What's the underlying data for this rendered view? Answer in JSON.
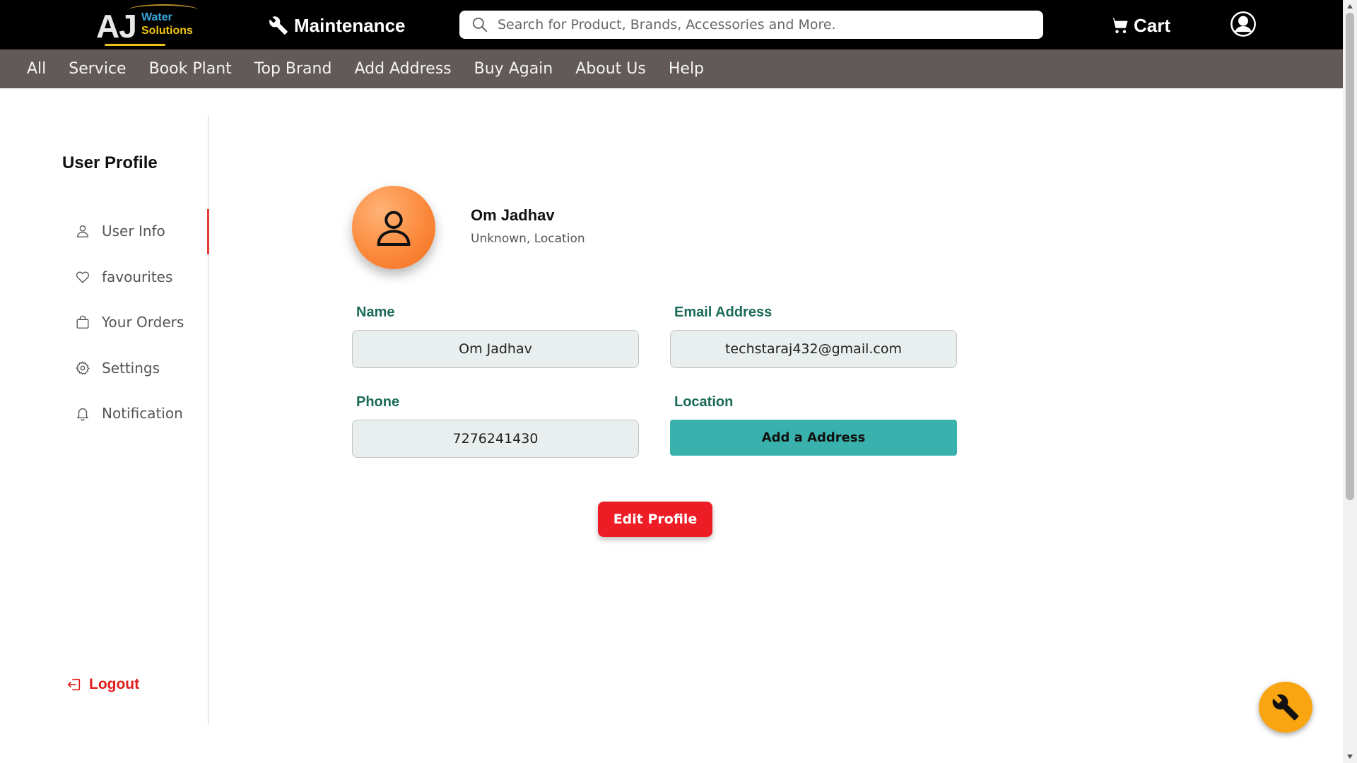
{
  "colors": {
    "topbar": "#000000",
    "navbar": "#625a58",
    "label_green": "#1b6b58",
    "address_button": "#39b2ad",
    "edit_button": "#ee1c25",
    "logout": "#e01b1b",
    "avatar": "#fb8a3c",
    "fab": "#f9a411"
  },
  "header": {
    "logo": {
      "main": "AJ",
      "line1": "Water",
      "line2": "Solutions"
    },
    "maintenance_label": "Maintenance",
    "maintenance_icon": "wrench-icon",
    "search_placeholder": "Search for Product, Brands, Accessories and More.",
    "cart_label": "Cart",
    "cart_icon": "cart-icon",
    "account_icon": "user-circle-icon"
  },
  "nav": {
    "items": [
      "All",
      "Service",
      "Book Plant",
      "Top Brand",
      "Add Address",
      "Buy Again",
      "About Us",
      "Help"
    ]
  },
  "sidebar": {
    "title": "User Profile",
    "items": [
      {
        "label": "User Info",
        "icon": "user-icon",
        "active": true
      },
      {
        "label": "favourites",
        "icon": "heart-icon",
        "active": false
      },
      {
        "label": "Your Orders",
        "icon": "bag-icon",
        "active": false
      },
      {
        "label": "Settings",
        "icon": "gear-icon",
        "active": false
      },
      {
        "label": "Notification",
        "icon": "bell-icon",
        "active": false
      }
    ],
    "logout_label": "Logout",
    "logout_icon": "logout-icon"
  },
  "profile": {
    "avatar_icon": "user-icon",
    "name": "Om Jadhav",
    "location": "Unknown, Location",
    "fields": {
      "name_label": "Name",
      "name_value": "Om Jadhav",
      "email_label": "Email Address",
      "email_value": "techstaraj432@gmail.com",
      "phone_label": "Phone",
      "phone_value": "7276241430",
      "location_label": "Location"
    },
    "add_address_button": "Add a Address",
    "edit_button": "Edit Profile"
  },
  "fab": {
    "icon": "wrench-icon"
  }
}
